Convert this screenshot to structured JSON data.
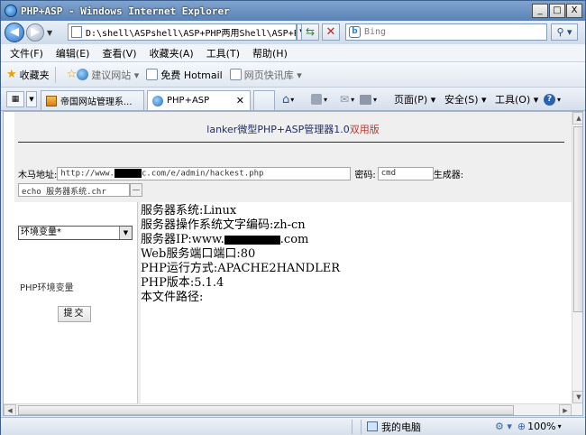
{
  "window": {
    "title": "PHP+ASP - Windows Internet Explorer",
    "buttons": {
      "minimize": "_",
      "maximize": "□",
      "close": "X"
    }
  },
  "address": {
    "url": "D:\\shell\\ASPshell\\ASP+PHP两用Shell\\ASP+PH",
    "search_placeholder": "Bing"
  },
  "menu": {
    "items": [
      "文件(F)",
      "编辑(E)",
      "查看(V)",
      "收藏夹(A)",
      "工具(T)",
      "帮助(H)"
    ]
  },
  "favorites": {
    "label": "收藏夹",
    "items": [
      {
        "label": "建议网站 ▾",
        "dim": true
      },
      {
        "label": "免费 Hotmail",
        "dim": false
      },
      {
        "label": "网页快讯库 ▾",
        "dim": true
      }
    ]
  },
  "tabs": [
    {
      "label": "帝国网站管理系..."
    },
    {
      "label": "PHP+ASP"
    }
  ],
  "commands": {
    "page": "页面(P) ▾",
    "safety": "安全(S) ▾",
    "tools": "工具(O) ▾"
  },
  "page": {
    "title_main": "lanker微型PHP+ASP管理器1.0",
    "title_version": "双用版",
    "trojan_label": "木马地址:",
    "trojan_url_prefix": "http://www.",
    "trojan_url_suffix": "c.com/e/admin/hackest.php",
    "password_label": "密码:",
    "password_value": "cmd",
    "generator_label": "生成器:",
    "command_value": "echo 服务器系统.chr",
    "select_value": "环境变量*",
    "env_label": "PHP环境变量",
    "submit_label": "提交",
    "output": {
      "os": "服务器系统:Linux",
      "encoding": "服务器操作系统文字编码:zh-cn",
      "ip_prefix": "服务器IP:www.",
      "ip_suffix": ".com",
      "port": "Web服务端口端口:80",
      "sapi": "PHP运行方式:APACHE2HANDLER",
      "version": "PHP版本:5.1.4",
      "path": "本文件路径:"
    }
  },
  "status": {
    "zone": "我的电脑",
    "zoom": "100%"
  },
  "colors": {
    "title_text": "#1f2d6a",
    "version_text": "#c0392b",
    "titlebar": "#5a82b6"
  }
}
